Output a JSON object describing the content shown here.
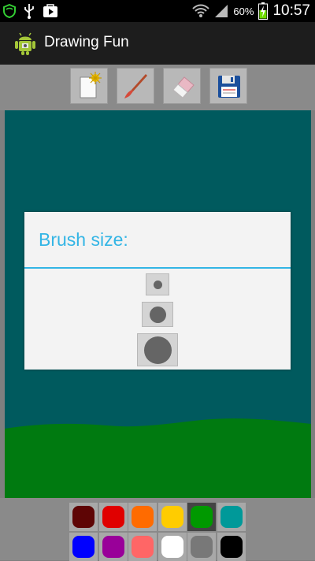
{
  "status_bar": {
    "battery_percent": "60%",
    "time": "10:57",
    "icons": [
      "shield-icon",
      "usb-icon",
      "play-store-icon",
      "wifi-icon",
      "signal-icon",
      "battery-charging-icon"
    ]
  },
  "app_bar": {
    "title": "Drawing Fun",
    "icon": "android-app-icon"
  },
  "toolbar": {
    "buttons": [
      "new-drawing",
      "brush",
      "eraser",
      "save"
    ]
  },
  "canvas": {
    "background": "#005a5e",
    "ground_color": "#007a10"
  },
  "dialog": {
    "title": "Brush size:",
    "options": [
      "small",
      "medium",
      "large"
    ]
  },
  "palette": {
    "rows": [
      [
        "#5e0505",
        "#e00000",
        "#ff6b00",
        "#ffcc00",
        "#009900",
        "#009999"
      ],
      [
        "#0000ff",
        "#990099",
        "#ff6666",
        "#ffffff",
        "#787878",
        "#000000"
      ]
    ],
    "selected": "#009900"
  }
}
